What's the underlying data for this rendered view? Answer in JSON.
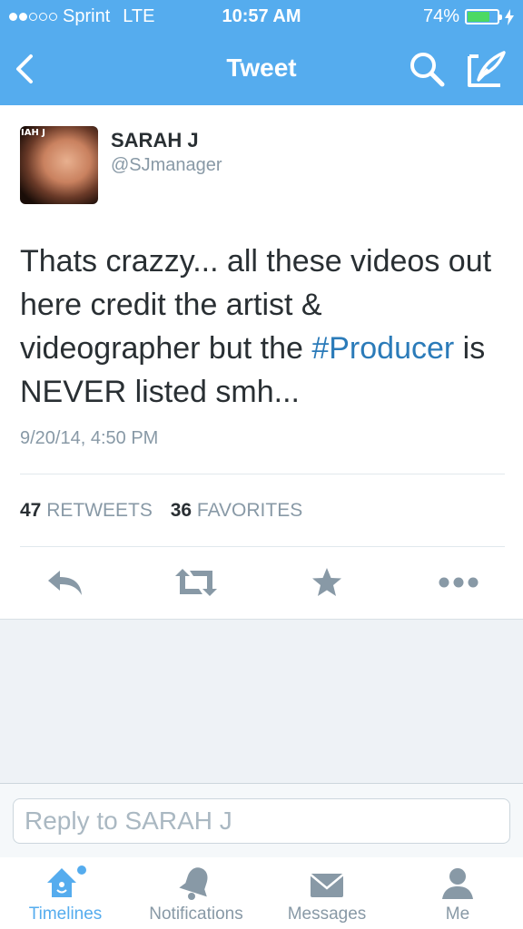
{
  "status_bar": {
    "carrier": "Sprint",
    "network": "LTE",
    "time": "10:57 AM",
    "battery": "74%",
    "battery_level": 0.74,
    "signal_bars": 2
  },
  "nav": {
    "title": "Tweet",
    "back_icon": "chevron-left-icon",
    "search_icon": "search-icon",
    "compose_icon": "compose-icon"
  },
  "tweet": {
    "author_name": "SARAH J",
    "author_handle": "@SJmanager",
    "avatar_tag": "IAH J",
    "text_before": "Thats crazzy... all these videos out here credit the artist & videographer but the ",
    "hashtag": "#Producer",
    "text_after": " is NEVER listed smh...",
    "timestamp": "9/20/14, 4:50 PM",
    "retweets_count": "47",
    "retweets_label": "RETWEETS",
    "favorites_count": "36",
    "favorites_label": "FAVORITES"
  },
  "actions": {
    "reply_icon": "reply-icon",
    "retweet_icon": "retweet-icon",
    "favorite_icon": "star-icon",
    "more_icon": "more-icon"
  },
  "reply": {
    "placeholder": "Reply to SARAH J"
  },
  "tabs": [
    {
      "label": "Timelines",
      "icon": "home-icon",
      "active": true
    },
    {
      "label": "Notifications",
      "icon": "bell-icon",
      "active": false
    },
    {
      "label": "Messages",
      "icon": "envelope-icon",
      "active": false
    },
    {
      "label": "Me",
      "icon": "person-icon",
      "active": false
    }
  ],
  "colors": {
    "brand": "#55acee",
    "hashtag": "#2b7bb9",
    "secondary_text": "#8899a6",
    "icon_gray": "#8899a6",
    "battery_green": "#4cd964"
  }
}
